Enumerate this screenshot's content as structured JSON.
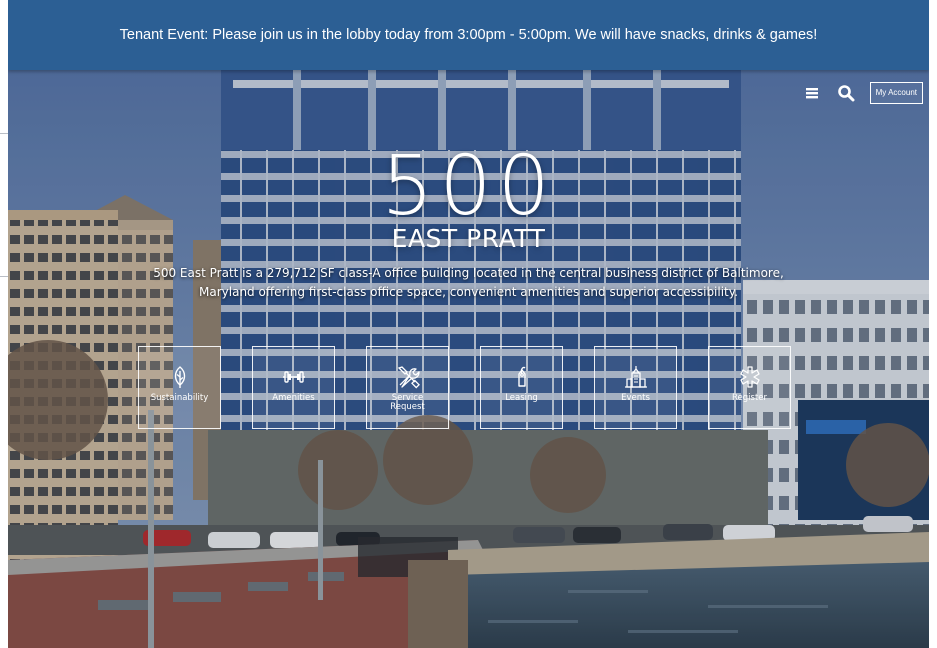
{
  "announcement": {
    "text": "Tenant Event: Please join us in the lobby today from 3:00pm - 5:00pm. We will have snacks, drinks & games!"
  },
  "nav": {
    "menu_icon": "hamburger-icon",
    "search_icon": "search-icon",
    "account_label": "My Account"
  },
  "hero": {
    "number": "500",
    "name": "EAST PRATT",
    "tagline": "500 East Pratt is a 279,712 SF class-A office building located in the central business district of Baltimore, Maryland offering first-class office space, convenient amenities and superior accessibility."
  },
  "tiles": [
    {
      "label": "Sustainability",
      "icon": "leaf-icon"
    },
    {
      "label": "Amenities",
      "icon": "dumbbell-icon"
    },
    {
      "label": "Service\nRequest",
      "icon": "tools-icon"
    },
    {
      "label": "Leasing",
      "icon": "key-tag-icon"
    },
    {
      "label": "Events",
      "icon": "building-icon"
    },
    {
      "label": "Register",
      "icon": "badge-icon"
    }
  ],
  "colors": {
    "banner": "#2c5f94",
    "text": "#ffffff"
  }
}
